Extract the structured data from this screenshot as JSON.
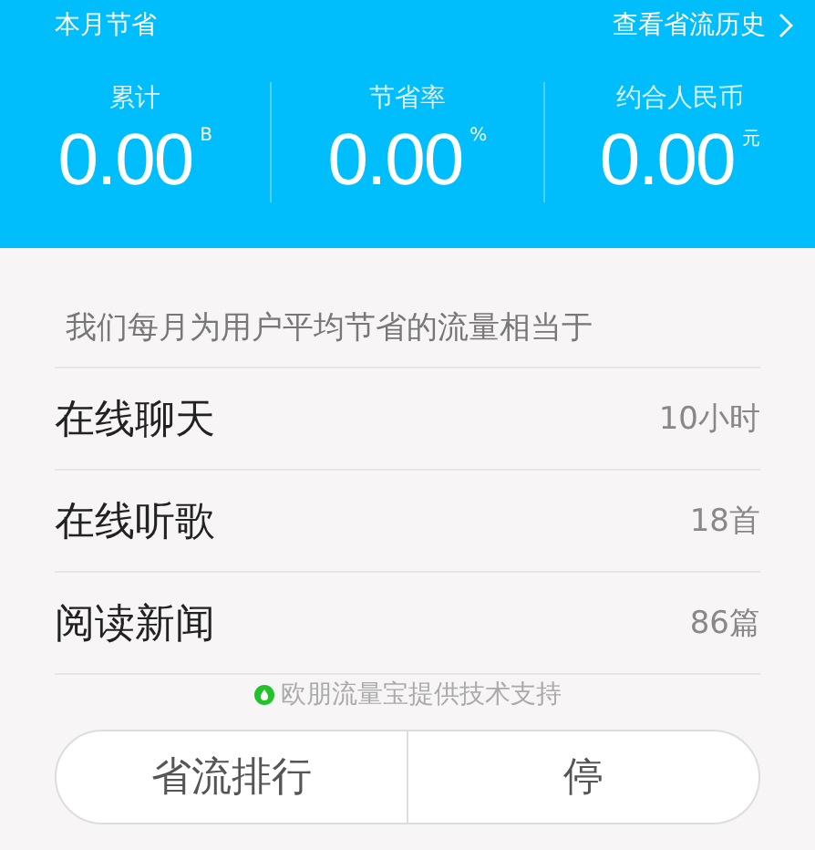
{
  "header": {
    "title": "本月节省",
    "history_link": "查看省流历史",
    "stats": [
      {
        "label": "累计",
        "value": "0.00",
        "unit": "B"
      },
      {
        "label": "节省率",
        "value": "0.00",
        "unit": "%"
      },
      {
        "label": "约合人民币",
        "value": "0.00",
        "unit": "元"
      }
    ]
  },
  "equivalents": {
    "heading": "我们每月为用户平均节省的流量相当于",
    "rows": [
      {
        "label": "在线聊天",
        "value": "10小时"
      },
      {
        "label": "在线听歌",
        "value": "18首"
      },
      {
        "label": "阅读新闻",
        "value": "86篇"
      }
    ]
  },
  "credit": "欧朋流量宝提供技术支持",
  "buttons": [
    "省流排行",
    "停"
  ]
}
